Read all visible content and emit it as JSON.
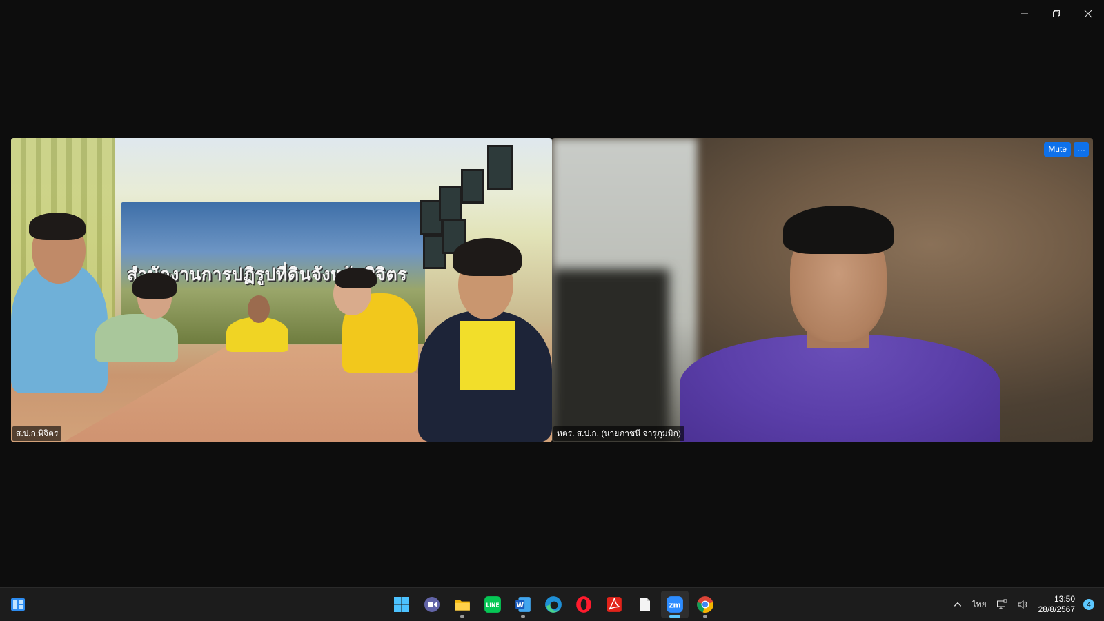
{
  "window": {
    "controls": [
      "minimize-icon",
      "restore-icon",
      "close-icon"
    ]
  },
  "meeting": {
    "left_tile": {
      "name": "ส.ป.ก.พิจิตร",
      "banner_text": "สำนักงานการปฏิรูปที่ดินจังหวัดพิจิตร"
    },
    "right_tile": {
      "name": "หตร. ส.ป.ก. (นายภาชนี  จารุภูมมิก)",
      "mute_label": "Mute",
      "more_label": "···"
    }
  },
  "taskbar": {
    "apps": [
      {
        "name": "windows-start",
        "icon": "windows-logo-icon"
      },
      {
        "name": "teams-chat",
        "icon": "video-chat-icon"
      },
      {
        "name": "file-explorer",
        "icon": "folder-icon"
      },
      {
        "name": "line",
        "icon": "line-app-icon",
        "label": "LINE"
      },
      {
        "name": "word",
        "icon": "word-icon",
        "label": "W"
      },
      {
        "name": "edge",
        "icon": "edge-browser-icon"
      },
      {
        "name": "opera",
        "icon": "opera-browser-icon"
      },
      {
        "name": "acrobat",
        "icon": "pdf-icon"
      },
      {
        "name": "notepad",
        "icon": "document-icon"
      },
      {
        "name": "zoom",
        "icon": "zoom-icon",
        "label": "zm"
      },
      {
        "name": "chrome",
        "icon": "chrome-browser-icon"
      }
    ],
    "tray": {
      "language": "ไทย",
      "time": "13:50",
      "date": "28/8/2567",
      "notification_count": "4"
    }
  },
  "colors": {
    "background": "#0d0d0d",
    "accent": "#0e71eb",
    "taskbar": "#1c1c1c"
  }
}
